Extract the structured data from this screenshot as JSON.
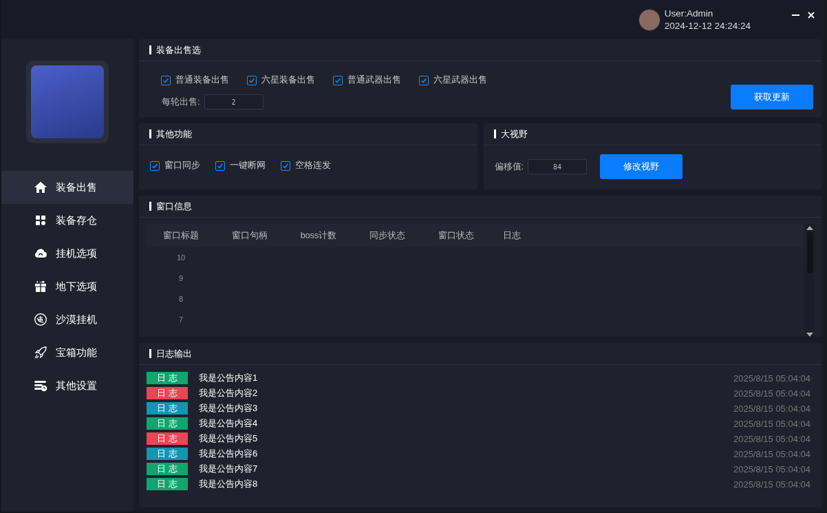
{
  "header": {
    "user": "User:Admin",
    "datetime": "2024-12-12 24:24:24"
  },
  "sidebar": {
    "items": [
      {
        "label": "装备出售",
        "kind": "home",
        "selected": true
      },
      {
        "label": "装备存仓",
        "kind": "grid",
        "selected": false
      },
      {
        "label": "挂机选项",
        "kind": "cloud",
        "selected": false
      },
      {
        "label": "地下选项",
        "kind": "gift",
        "selected": false
      },
      {
        "label": "沙漠挂机",
        "kind": "badge",
        "selected": false
      },
      {
        "label": "宝箱功能",
        "kind": "rocket",
        "selected": false
      },
      {
        "label": "其他设置",
        "kind": "stack",
        "selected": false
      }
    ]
  },
  "sale_panel": {
    "title": "装备出售选",
    "options": [
      {
        "label": "普通装备出售",
        "checked": true
      },
      {
        "label": "六星装备出售",
        "checked": true
      },
      {
        "label": "普通武器出售",
        "checked": true
      },
      {
        "label": "六星武器出售",
        "checked": true
      }
    ],
    "per_round_label": "每轮出售:",
    "per_round_value": "2",
    "button": "获取更新"
  },
  "other_panel": {
    "title": "其他功能",
    "options": [
      {
        "label": "窗口同步",
        "checked": true
      },
      {
        "label": "一键断网",
        "checked": true
      },
      {
        "label": "空格连发",
        "checked": true
      }
    ]
  },
  "view_panel": {
    "title": "大视野",
    "offset_label": "偏移值:",
    "offset_value": "84",
    "button": "修改视野"
  },
  "window_panel": {
    "title": "窗口信息",
    "columns": [
      "窗口标题",
      "窗口句柄",
      "boss计数",
      "同步状态",
      "窗口状态",
      "日志"
    ],
    "rows": [
      [
        "10"
      ],
      [
        "9"
      ],
      [
        "8"
      ],
      [
        "7"
      ]
    ]
  },
  "log_panel": {
    "title": "日志输出",
    "entries": [
      {
        "tag": "日 志",
        "color": "#12a56f",
        "text": "我是公告内容1",
        "time": "2025/8/15 05:04:04"
      },
      {
        "tag": "日 志",
        "color": "#ef4452",
        "text": "我是公告内容2",
        "time": "2025/8/15 05:04:04"
      },
      {
        "tag": "日 志",
        "color": "#1196b3",
        "text": "我是公告内容3",
        "time": "2025/8/15 05:04:04"
      },
      {
        "tag": "日 志",
        "color": "#12a56f",
        "text": "我是公告内容4",
        "time": "2025/8/15 05:04:04"
      },
      {
        "tag": "日 志",
        "color": "#ef4452",
        "text": "我是公告内容5",
        "time": "2025/8/15 05:04:04"
      },
      {
        "tag": "日 志",
        "color": "#1196b3",
        "text": "我是公告内容6",
        "time": "2025/8/15 05:04:04"
      },
      {
        "tag": "日 志",
        "color": "#12a56f",
        "text": "我是公告内容7",
        "time": "2025/8/15 05:04:04"
      },
      {
        "tag": "日 志",
        "color": "#12a56f",
        "text": "我是公告内容8",
        "time": "2025/8/15 05:04:04"
      }
    ]
  }
}
